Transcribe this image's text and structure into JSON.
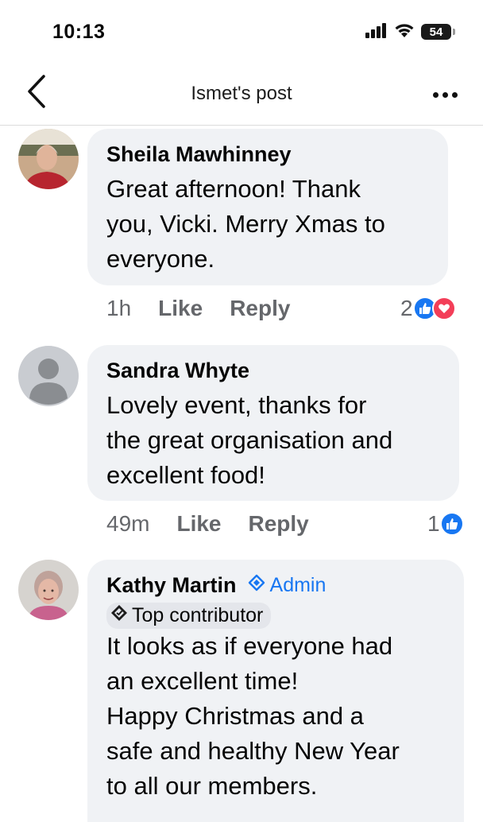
{
  "status": {
    "time": "10:13",
    "battery": "54",
    "icons": [
      "signal-icon",
      "wifi-icon",
      "battery-icon"
    ]
  },
  "header": {
    "title": "Ismet's post",
    "back_icon": "chevron-left-icon",
    "more_icon": "more-dots-icon"
  },
  "comments": [
    {
      "author": "Sheila Mawhinney",
      "text": "Great afternoon! Thank\nyou, Vicki. Merry Xmas to\neveryone.",
      "time": "1h",
      "like_label": "Like",
      "reply_label": "Reply",
      "reaction_count": "2",
      "reactions": [
        "like",
        "love"
      ]
    },
    {
      "author": "Sandra Whyte",
      "text": "Lovely event, thanks for\nthe great organisation and\nexcellent food!",
      "time": "49m",
      "like_label": "Like",
      "reply_label": "Reply",
      "reaction_count": "1",
      "reactions": [
        "like"
      ]
    },
    {
      "author": "Kathy Martin",
      "admin_label": "Admin",
      "contributor_label": "Top contributor",
      "text": "It looks as if everyone had\nan excellent time!\nHappy Christmas and a\nsafe and healthy New Year\nto all our members."
    }
  ],
  "colors": {
    "bubble": "#f0f2f5",
    "accent": "#1877f2",
    "love": "#f33e58",
    "meta_text": "#65676b"
  }
}
